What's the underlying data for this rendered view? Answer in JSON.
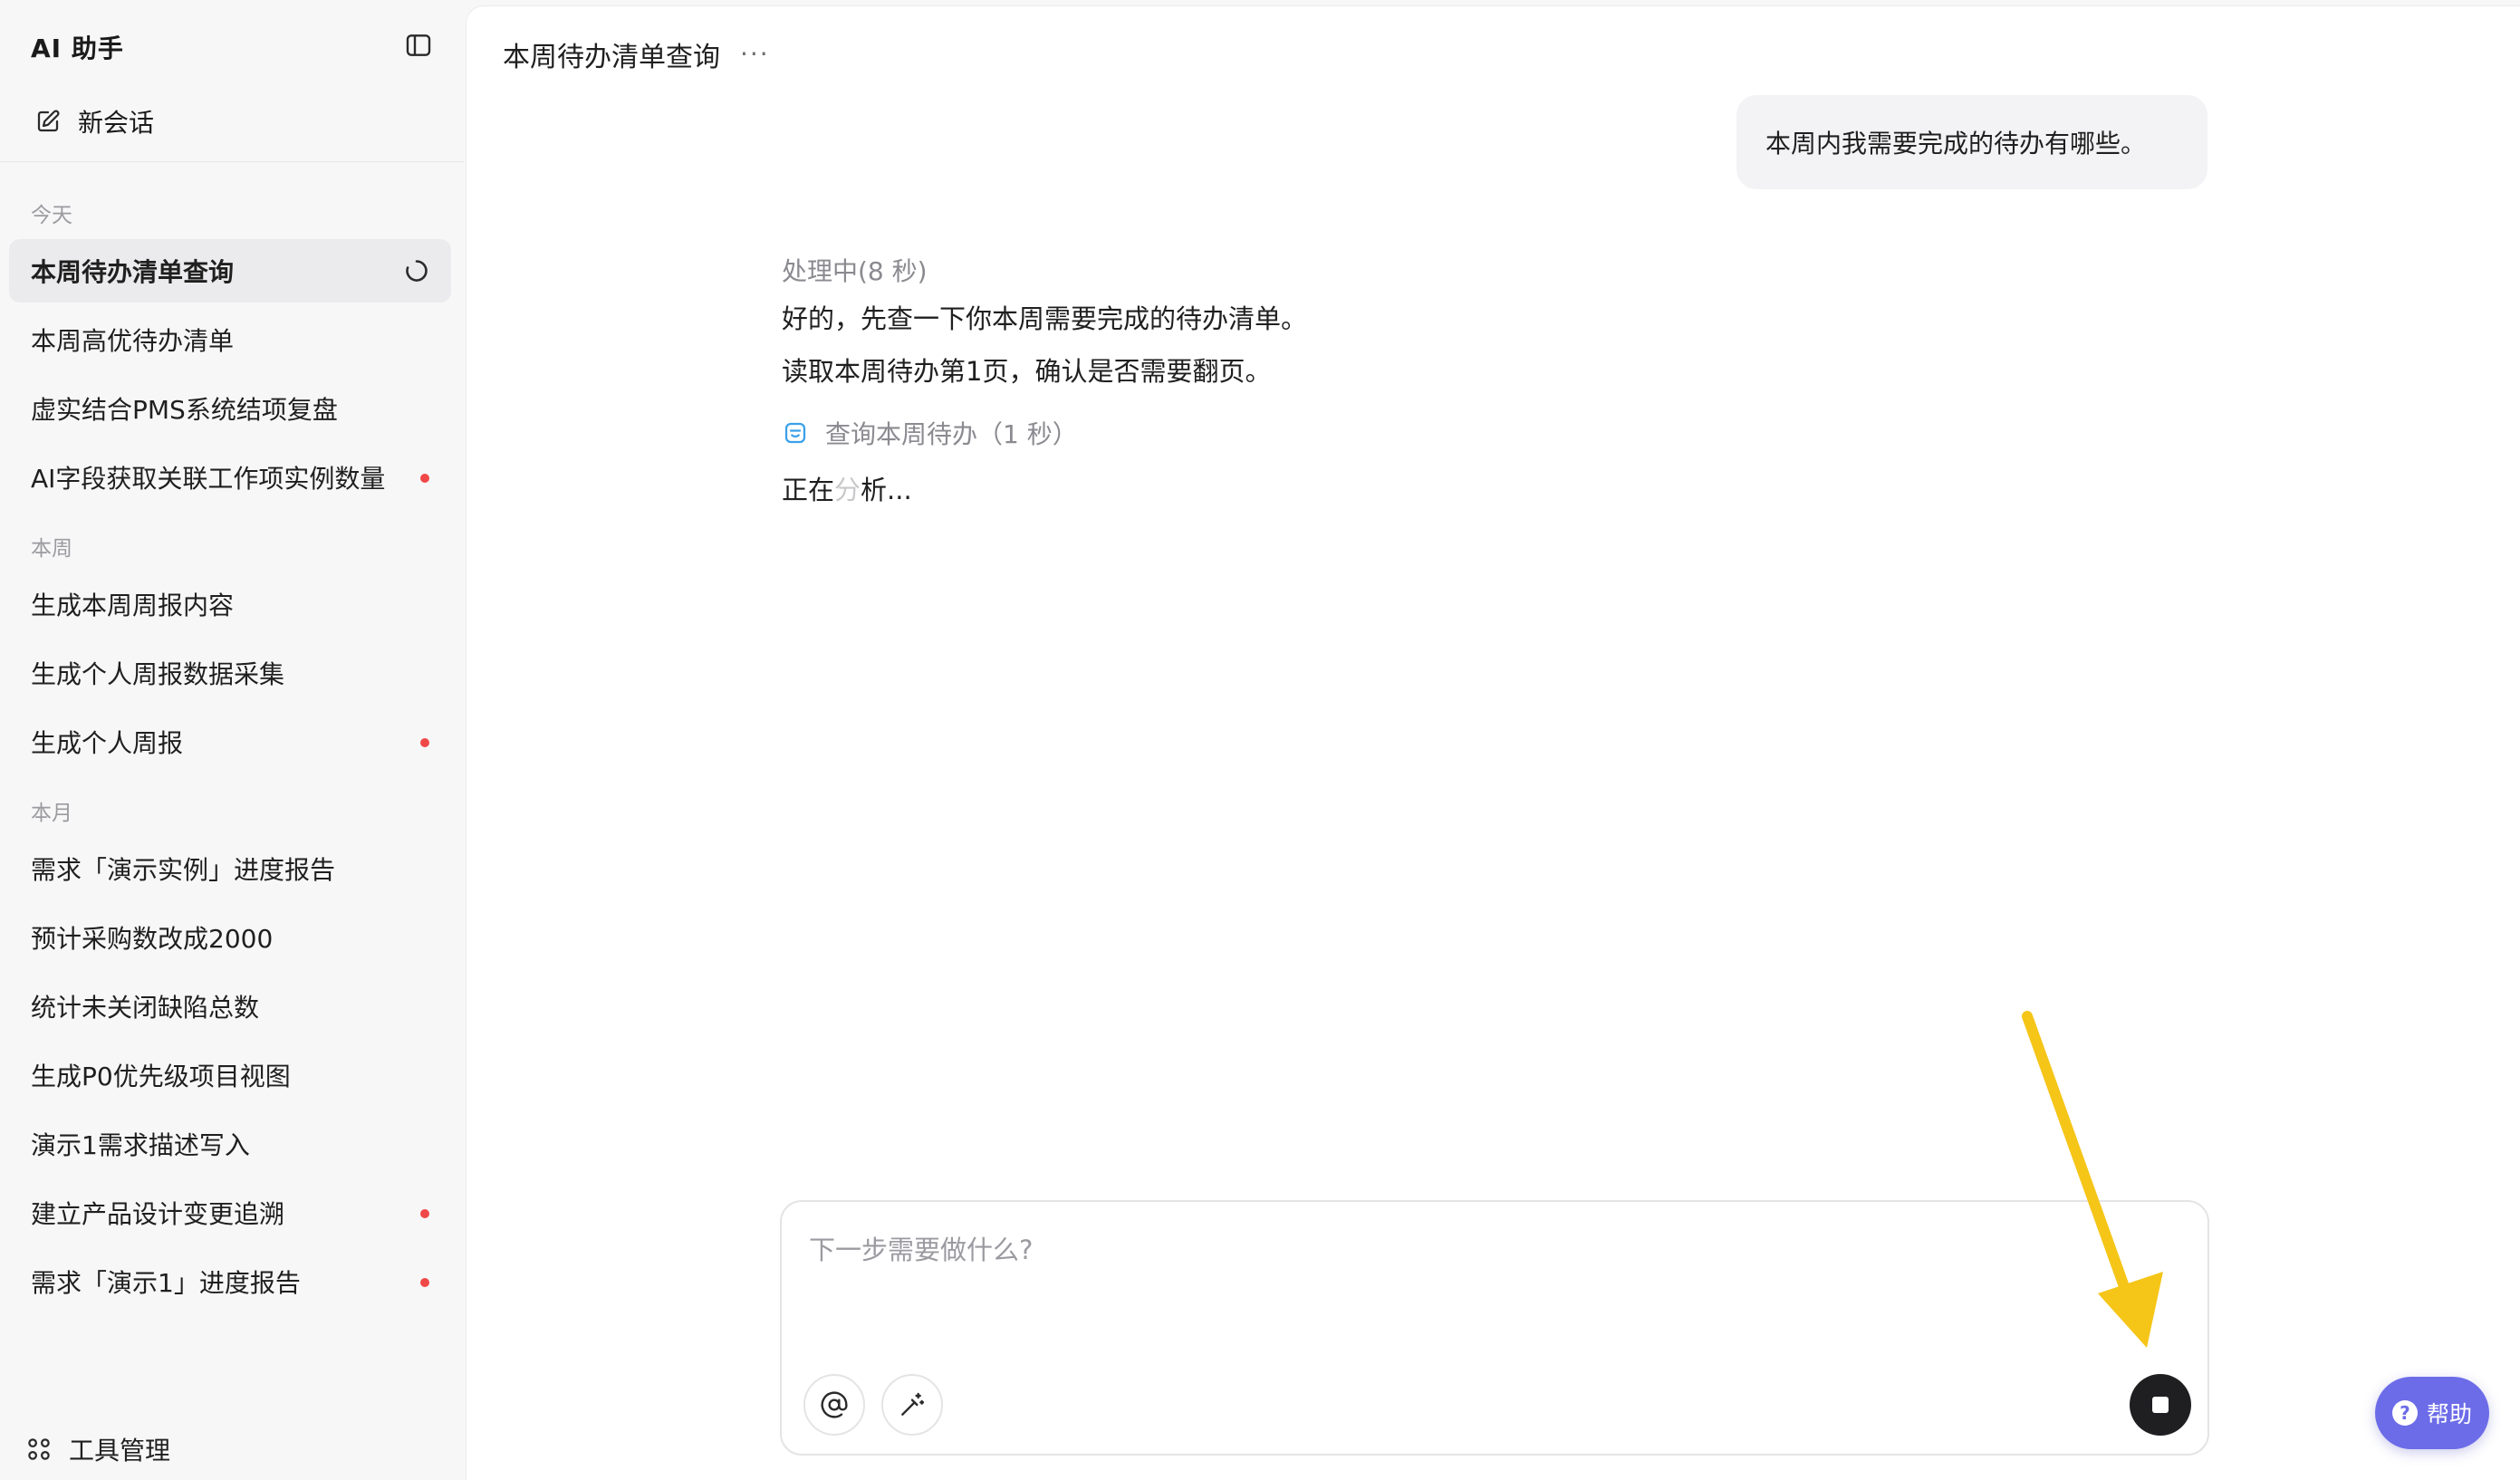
{
  "app": {
    "title": "AI 助手"
  },
  "sidebar": {
    "new_chat_label": "新会话",
    "sections": [
      {
        "label": "今天",
        "items": [
          {
            "label": "本周待办清单查询",
            "active": true,
            "status": "loading"
          },
          {
            "label": "本周高优待办清单"
          },
          {
            "label": "虚实结合PMS系统结项复盘"
          },
          {
            "label": "AI字段获取关联工作项实例数量",
            "unread": true
          }
        ]
      },
      {
        "label": "本周",
        "items": [
          {
            "label": "生成本周周报内容"
          },
          {
            "label": "生成个人周报数据采集"
          },
          {
            "label": "生成个人周报",
            "unread": true
          }
        ]
      },
      {
        "label": "本月",
        "items": [
          {
            "label": "需求「演示实例」进度报告"
          },
          {
            "label": "预计采购数改成2000"
          },
          {
            "label": "统计未关闭缺陷总数"
          },
          {
            "label": "生成P0优先级项目视图"
          },
          {
            "label": "演示1需求描述写入"
          },
          {
            "label": "建立产品设计变更追溯",
            "unread": true
          },
          {
            "label": "需求「演示1」进度报告",
            "unread": true
          }
        ]
      }
    ],
    "tools_label": "工具管理"
  },
  "conversation": {
    "title": "本周待办清单查询",
    "more_label": "···",
    "user_message": "本周内我需要完成的待办有哪些。",
    "assistant": {
      "status": "处理中(8 秒)",
      "lines": [
        "好的，先查一下你本周需要完成的待办清单。",
        "读取本周待办第1页，确认是否需要翻页。"
      ],
      "tool_call": "查询本周待办（1 秒）",
      "analyzing_prefix": "正在",
      "analyzing_fade": "分",
      "analyzing_suffix": "析..."
    }
  },
  "input": {
    "placeholder": "下一步需要做什么?"
  },
  "help": {
    "label": "帮助"
  },
  "colors": {
    "accent": "#6c6ce8",
    "unread_dot": "#f04848",
    "annotation_arrow": "#f5c518"
  }
}
